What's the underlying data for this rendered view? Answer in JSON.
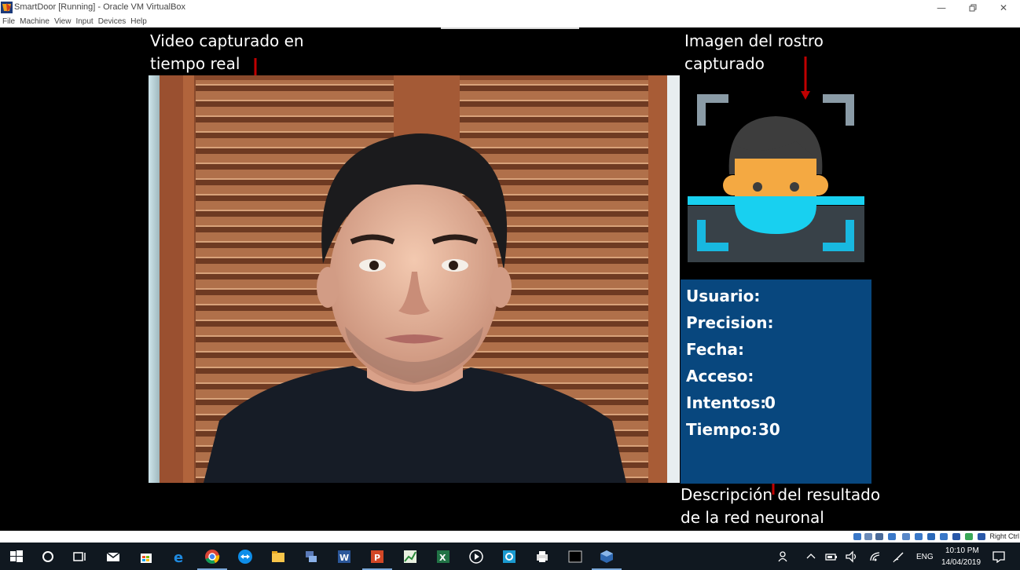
{
  "window": {
    "title": "SmartDoor [Running] - Oracle VM VirtualBox",
    "minimize_icon": "minimize-icon",
    "restore_icon": "restore-icon",
    "close_icon": "close-icon"
  },
  "menu": [
    "File",
    "Machine",
    "View",
    "Input",
    "Devices",
    "Help"
  ],
  "annotations": {
    "video": "Video capturado en\ntiempo real",
    "face": "Imagen del rostro\ncapturado",
    "description": "Descripción del resultado\nde la red neuronal"
  },
  "result": {
    "usuario_label": "Usuario:",
    "precision_label": "Precision:",
    "fecha_label": "Fecha:",
    "acceso_label": "Acceso:",
    "intentos_label": "Intentos:",
    "intentos_value": "0",
    "tiempo_label": "Tiempo:",
    "tiempo_value": "30"
  },
  "statusbar": {
    "host_key": "Right Ctrl"
  },
  "taskbar": {
    "language": "ENG",
    "time": "10:10 PM",
    "date": "14/04/2019"
  },
  "colors": {
    "panel_blue": "#08477e",
    "arrow_red": "#c00000",
    "face_skin": "#f4a942",
    "face_hair": "#3d3d3d",
    "mask_cyan": "#18d0f0"
  }
}
